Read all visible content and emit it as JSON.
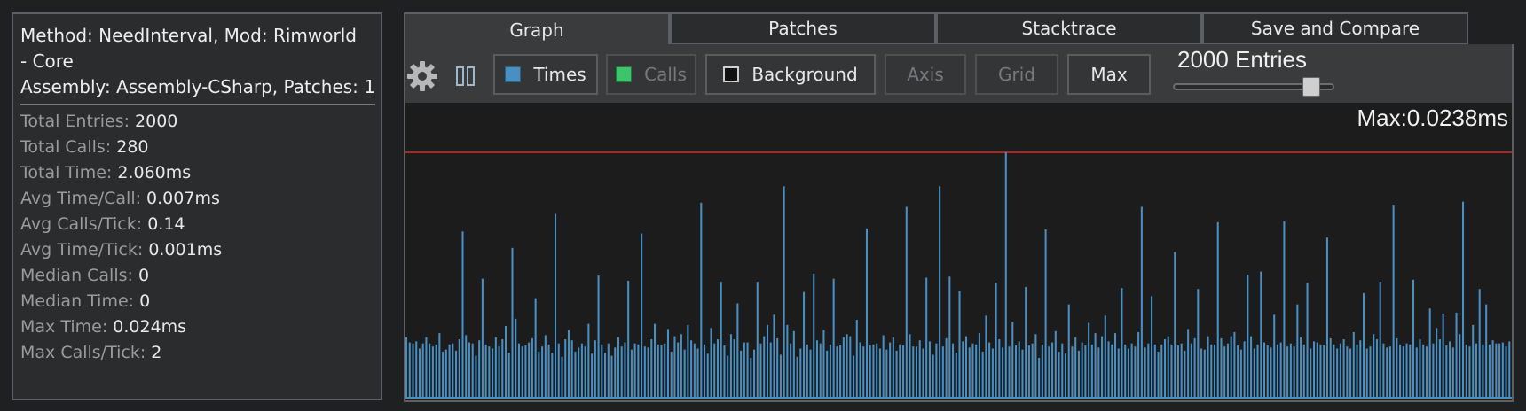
{
  "stats": {
    "header_line1": "Method: NeedInterval, Mod: Rimworld",
    "header_line2": "- Core",
    "header_line3": "Assembly: Assembly-CSharp, Patches: 1",
    "rows": [
      {
        "label": "Total Entries: ",
        "value": "2000"
      },
      {
        "label": "Total Calls: ",
        "value": "280"
      },
      {
        "label": "Total Time: ",
        "value": "2.060ms"
      },
      {
        "label": "Avg Time/Call: ",
        "value": "0.007ms"
      },
      {
        "label": "Avg Calls/Tick: ",
        "value": "0.14"
      },
      {
        "label": "Avg Time/Tick: ",
        "value": "0.001ms"
      },
      {
        "label": "Median Calls: ",
        "value": "0"
      },
      {
        "label": "Median Time: ",
        "value": "0"
      },
      {
        "label": "Max Time: ",
        "value": "0.024ms"
      },
      {
        "label": "Max Calls/Tick: ",
        "value": "2"
      }
    ]
  },
  "tabs": [
    "Graph",
    "Patches",
    "Stacktrace",
    "Save and Compare"
  ],
  "active_tab": "Graph",
  "toolbar": {
    "gear_icon": "gear-icon",
    "pause_icon": "pause-icon",
    "times_label": "Times",
    "times_checked": true,
    "times_color": "#4a8fc1",
    "calls_label": "Calls",
    "calls_checked": true,
    "calls_color": "#3ec46a",
    "background_label": "Background",
    "background_checked": false,
    "axis_label": "Axis",
    "grid_label": "Grid",
    "max_label": "Max",
    "entries_label": "2000 Entries",
    "entries_slider_fraction": 0.9
  },
  "graph": {
    "max_label": "Max:0.0238ms",
    "bar_color": "#4a8fc1",
    "max_line_color": "#b3261e"
  },
  "chart_data": {
    "type": "bar",
    "series": [
      {
        "values": [
          0.0058,
          0.0053,
          0.0052,
          0.0054,
          0.0047,
          0.0052,
          0.0058,
          0.0052,
          0.0049,
          0.0051,
          0.0062,
          0.0044,
          0.0046,
          0.0051,
          0.0052,
          0.0045,
          0.0056,
          0.0161,
          0.006,
          0.0053,
          0.0052,
          0.004,
          0.0055,
          0.0115,
          0.0051,
          0.0049,
          0.0047,
          0.0058,
          0.0049,
          0.0056,
          0.0069,
          0.0043,
          0.0145,
          0.0076,
          0.0052,
          0.0049,
          0.005,
          0.0053,
          0.0057,
          0.0096,
          0.0044,
          0.0049,
          0.006,
          0.0051,
          0.0043,
          0.0178,
          0.0052,
          0.0039,
          0.0056,
          0.0065,
          0.0055,
          0.0044,
          0.0048,
          0.0052,
          0.0049,
          0.0071,
          0.0042,
          0.0055,
          0.0118,
          0.0051,
          0.0043,
          0.0052,
          0.004,
          0.0048,
          0.0058,
          0.0049,
          0.0053,
          0.0113,
          0.0046,
          0.0052,
          0.0051,
          0.0159,
          0.0049,
          0.0048,
          0.0056,
          0.0071,
          0.0051,
          0.005,
          0.0052,
          0.0066,
          0.0044,
          0.0059,
          0.0053,
          0.0061,
          0.0046,
          0.007,
          0.0055,
          0.0052,
          0.0047,
          0.0189,
          0.0051,
          0.0042,
          0.0067,
          0.0052,
          0.0056,
          0.0112,
          0.005,
          0.004,
          0.0061,
          0.0056,
          0.0091,
          0.0045,
          0.0053,
          0.0053,
          0.0038,
          0.0046,
          0.0112,
          0.0052,
          0.0059,
          0.007,
          0.0053,
          0.008,
          0.0057,
          0.0041,
          0.0205,
          0.007,
          0.0052,
          0.0064,
          0.0039,
          0.0047,
          0.0102,
          0.0051,
          0.0046,
          0.012,
          0.0055,
          0.0052,
          0.0065,
          0.0045,
          0.0051,
          0.0115,
          0.0049,
          0.005,
          0.0058,
          0.0061,
          0.0059,
          0.004,
          0.0075,
          0.0053,
          0.0049,
          0.0164,
          0.005,
          0.0051,
          0.0052,
          0.0047,
          0.006,
          0.0046,
          0.0053,
          0.0058,
          0.0045,
          0.0051,
          0.005,
          0.0185,
          0.0061,
          0.0049,
          0.0049,
          0.0055,
          0.0047,
          0.0116,
          0.0054,
          0.0041,
          0.0052,
          0.0205,
          0.0049,
          0.0057,
          0.0117,
          0.0052,
          0.0043,
          0.0103,
          0.0054,
          0.0059,
          0.0048,
          0.0052,
          0.0051,
          0.0062,
          0.0044,
          0.0079,
          0.0053,
          0.0047,
          0.0111,
          0.0056,
          0.0048,
          0.0238,
          0.0049,
          0.0073,
          0.005,
          0.0054,
          0.0046,
          0.0107,
          0.005,
          0.0052,
          0.0061,
          0.0038,
          0.0051,
          0.0163,
          0.0049,
          0.0053,
          0.0064,
          0.0044,
          0.0052,
          0.0042,
          0.009,
          0.0049,
          0.0058,
          0.0045,
          0.0053,
          0.005,
          0.0072,
          0.0051,
          0.0062,
          0.0048,
          0.0059,
          0.0079,
          0.0054,
          0.0051,
          0.0062,
          0.0047,
          0.0106,
          0.0051,
          0.0047,
          0.0052,
          0.0049,
          0.0063,
          0.0185,
          0.0048,
          0.0052,
          0.0098,
          0.0051,
          0.0044,
          0.0051,
          0.0056,
          0.0059,
          0.0051,
          0.0141,
          0.005,
          0.0052,
          0.0045,
          0.0066,
          0.0052,
          0.0057,
          0.0105,
          0.0047,
          0.0046,
          0.0059,
          0.0051,
          0.0051,
          0.017,
          0.0057,
          0.0049,
          0.0052,
          0.0059,
          0.0063,
          0.005,
          0.0046,
          0.0054,
          0.0119,
          0.0059,
          0.0047,
          0.0051,
          0.0122,
          0.0053,
          0.005,
          0.0048,
          0.008,
          0.0051,
          0.0053,
          0.0171,
          0.0049,
          0.0052,
          0.0049,
          0.009,
          0.0058,
          0.0051,
          0.0111,
          0.0047,
          0.0054,
          0.0053,
          0.0051,
          0.005,
          0.0155,
          0.0057,
          0.0051,
          0.0047,
          0.0052,
          0.0056,
          0.0049,
          0.0047,
          0.0063,
          0.0051,
          0.0055,
          0.0101,
          0.0047,
          0.0049,
          0.0061,
          0.0056,
          0.0112,
          0.0052,
          0.0048,
          0.0049,
          0.0187,
          0.0057,
          0.0051,
          0.0049,
          0.0052,
          0.0051,
          0.0114,
          0.0048,
          0.0056,
          0.0051,
          0.0049,
          0.0086,
          0.0052,
          0.0067,
          0.0056,
          0.0081,
          0.005,
          0.0054,
          0.0048,
          0.0082,
          0.0061,
          0.019,
          0.0051,
          0.0049,
          0.007,
          0.0052,
          0.0105,
          0.0051,
          0.009,
          0.0051,
          0.0055,
          0.0052,
          0.0052,
          0.0053,
          0.0049,
          0.0054
        ]
      }
    ],
    "ylim": [
      0,
      0.0238
    ],
    "reference_line": 0.0238,
    "grid": false,
    "legend": "none"
  }
}
